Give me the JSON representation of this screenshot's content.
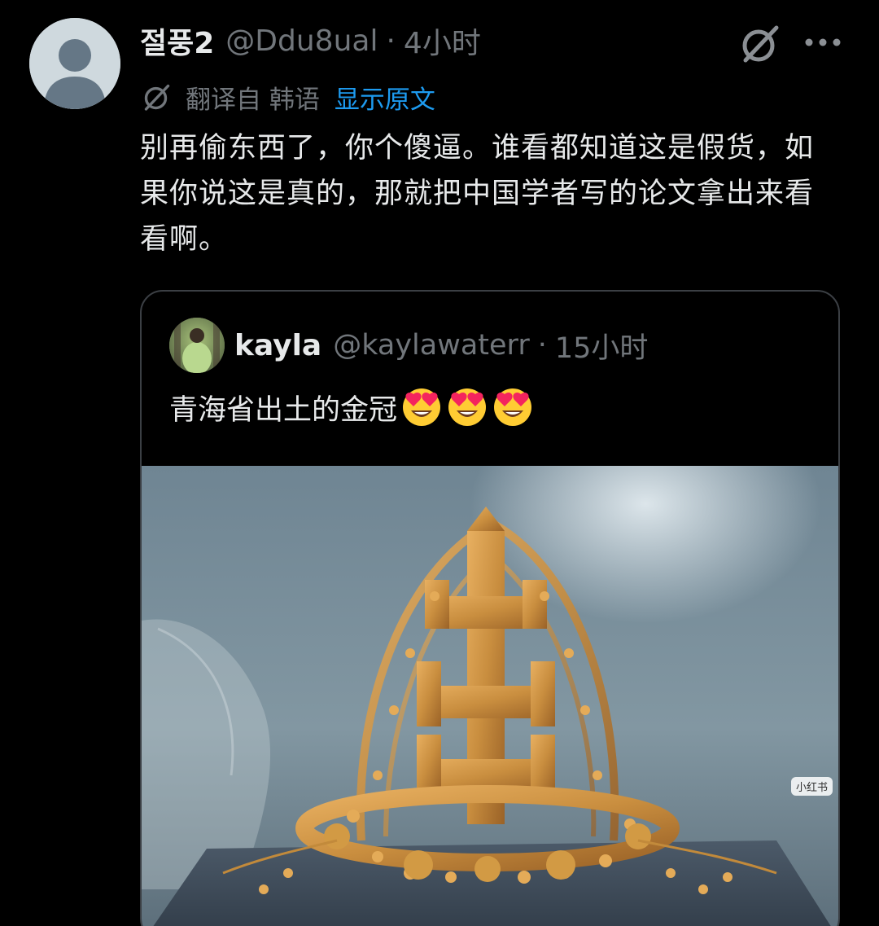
{
  "tweet": {
    "author": {
      "display_name": "절풍2",
      "handle": "@Ddu8ual",
      "separator": "·",
      "time": "4小时"
    },
    "translation": {
      "translated_from": "翻译自 韩语",
      "show_original": "显示原文"
    },
    "text": "别再偷东西了，你个傻逼。谁看都知道这是假货，如果你说这是真的，那就把中国学者写的论文拿出来看看啊。",
    "icons": {
      "grok": "grok-icon",
      "more": "more-icon",
      "translate": "translate-icon"
    }
  },
  "quoted_tweet": {
    "author": {
      "display_name": "kayla",
      "handle": "@kaylawaterr",
      "separator": "·",
      "time": "15小时"
    },
    "text": "青海省出土的金冠",
    "emojis": [
      "smiling-face-with-heart-eyes",
      "smiling-face-with-heart-eyes",
      "smiling-face-with-heart-eyes"
    ],
    "image": {
      "subject": "golden crown in museum display case",
      "watermark": "小红书"
    }
  },
  "colors": {
    "background": "#000000",
    "text_primary": "#e7e9ea",
    "text_secondary": "#71767b",
    "link": "#1d9bf0",
    "border": "#3b3f44"
  }
}
